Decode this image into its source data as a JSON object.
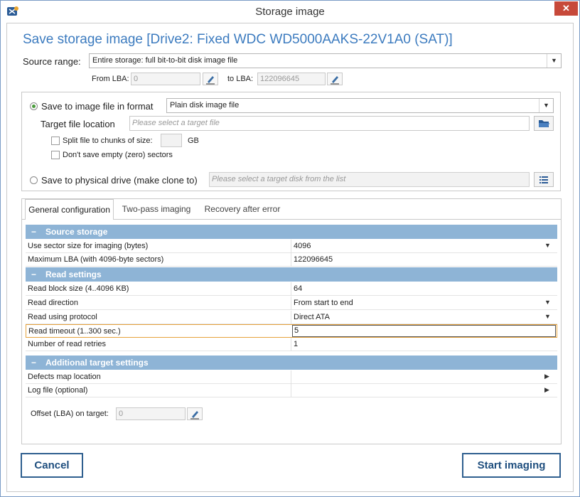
{
  "window": {
    "title": "Storage image",
    "close_label": "✕"
  },
  "heading": "Save storage image [Drive2: Fixed WDC WD5000AAKS-22V1A0 (SAT)]",
  "source": {
    "label": "Source range:",
    "value": "Entire storage: full bit-to-bit disk image file",
    "from_label": "From LBA:",
    "from_value": "0",
    "to_label": "to LBA:",
    "to_value": "122096645"
  },
  "save_image": {
    "label": "Save to image file in format",
    "format_value": "Plain disk image file",
    "target_label": "Target file location",
    "target_placeholder": "Please select a target file",
    "split_label": "Split file to chunks of size:",
    "split_unit": "GB",
    "empty_label": "Don't save empty (zero) sectors"
  },
  "save_drive": {
    "label": "Save to physical drive (make clone to)",
    "placeholder": "Please select a target disk from the list"
  },
  "tabs": [
    {
      "label": "General configuration"
    },
    {
      "label": "Two-pass imaging"
    },
    {
      "label": "Recovery after error"
    }
  ],
  "sections": {
    "source_storage": {
      "title": "Source storage",
      "rows": [
        {
          "key": "Use sector size for imaging (bytes)",
          "value": "4096"
        },
        {
          "key": "Maximum LBA (with 4096-byte sectors)",
          "value": "122096645"
        }
      ]
    },
    "read_settings": {
      "title": "Read settings",
      "rows": [
        {
          "key": "Read block size (4..4096 KB)",
          "value": "64"
        },
        {
          "key": "Read direction",
          "value": "From start to end"
        },
        {
          "key": "Read using protocol",
          "value": "Direct ATA"
        },
        {
          "key": "Read timeout (1..300 sec.)",
          "value": "5"
        },
        {
          "key": "Number of read retries",
          "value": "1"
        }
      ]
    },
    "target_settings": {
      "title": "Additional target settings",
      "rows": [
        {
          "key": "Defects map location",
          "value": ""
        },
        {
          "key": "Log file (optional)",
          "value": ""
        }
      ]
    }
  },
  "offset": {
    "label": "Offset (LBA) on target:",
    "value": "0"
  },
  "buttons": {
    "cancel": "Cancel",
    "start": "Start imaging"
  },
  "colors": {
    "accent": "#3c7bbf",
    "section_header": "#8eb4d6",
    "focus": "#e6a23c",
    "close": "#c7493a"
  }
}
